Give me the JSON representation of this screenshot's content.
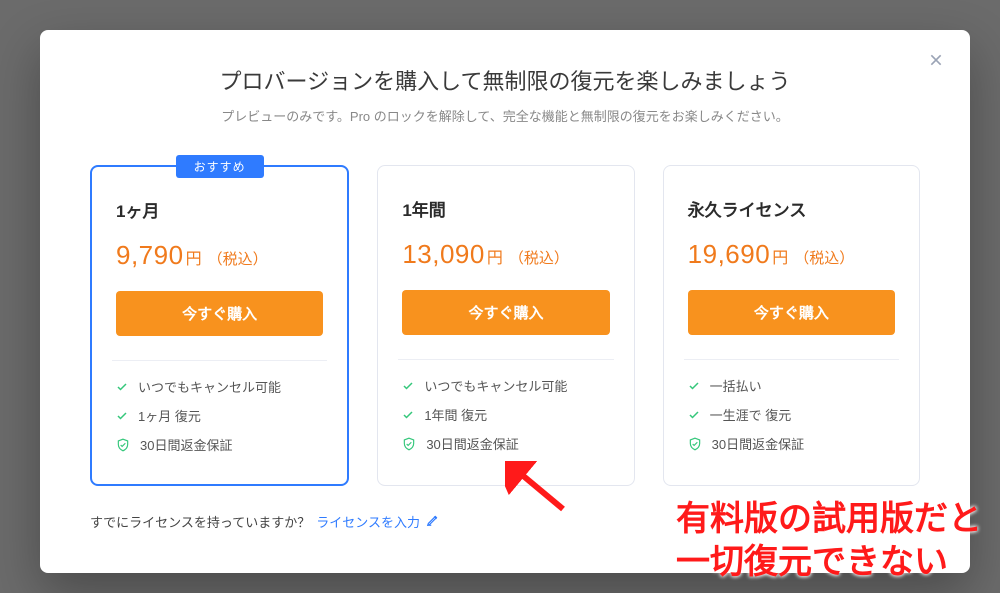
{
  "modal": {
    "title": "プロバージョンを購入して無制限の復元を楽しみましょう",
    "subtitle": "プレビューのみです。Pro のロックを解除して、完全な機能と無制限の復元をお楽しみください。"
  },
  "badge": "おすすめ",
  "buy_label": "今すぐ購入",
  "tax_label": "（税込）",
  "yen": "円",
  "plans": [
    {
      "name": "1ヶ月",
      "price": "9,790",
      "features": [
        "いつでもキャンセル可能",
        "1ヶ月 復元"
      ],
      "guarantee": "30日間返金保証"
    },
    {
      "name": "1年間",
      "price": "13,090",
      "features": [
        "いつでもキャンセル可能",
        "1年間 復元"
      ],
      "guarantee": "30日間返金保証"
    },
    {
      "name": "永久ライセンス",
      "price": "19,690",
      "features": [
        "一括払い",
        "一生涯で 復元"
      ],
      "guarantee": "30日間返金保証"
    }
  ],
  "license": {
    "question": "すでにライセンスを持っていますか？",
    "link": "ライセンスを入力"
  },
  "annotation": {
    "line1": "有料版の試用版だと",
    "line2": "一切復元できない"
  }
}
